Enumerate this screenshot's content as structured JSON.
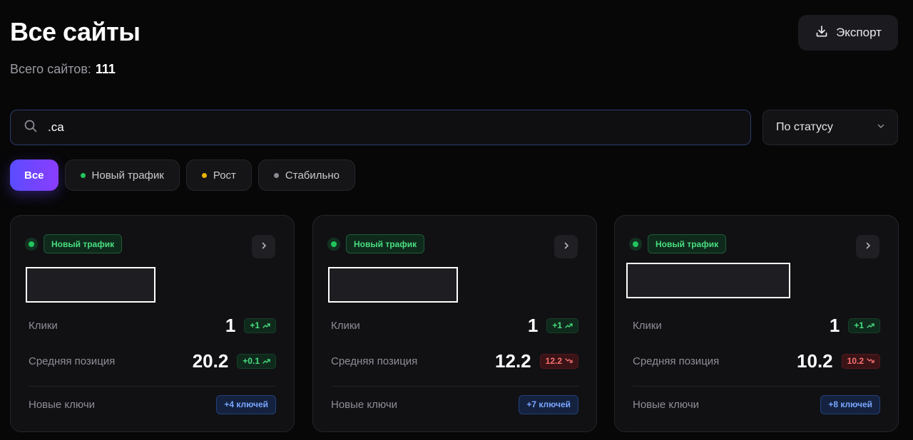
{
  "header": {
    "title": "Все сайты",
    "total_label": "Всего сайтов:",
    "total_value": "111",
    "export_label": "Экспорт"
  },
  "search": {
    "value": ".ca",
    "placeholder": ""
  },
  "status_select": {
    "selected": "По статусу"
  },
  "filters": [
    {
      "label": "Все",
      "active": true
    },
    {
      "label": "Новый трафик",
      "dot_color": "#22c55e"
    },
    {
      "label": "Рост",
      "dot_color": "#eab308"
    },
    {
      "label": "Стабильно",
      "dot_color": "#8a8a93"
    }
  ],
  "cards": [
    {
      "status": "Новый трафик",
      "clicks_label": "Клики",
      "clicks_value": "1",
      "clicks_delta": "+1",
      "position_label": "Средняя позиция",
      "position_value": "20.2",
      "position_delta": "+0.1",
      "keys_label": "Новые ключи",
      "keys_value": "+4 ключей"
    },
    {
      "status": "Новый трафик",
      "clicks_label": "Клики",
      "clicks_value": "1",
      "clicks_delta": "+1",
      "position_label": "Средняя позиция",
      "position_value": "12.2",
      "position_delta": "12.2",
      "keys_label": "Новые ключи",
      "keys_value": "+7 ключей"
    },
    {
      "status": "Новый трафик",
      "clicks_label": "Клики",
      "clicks_value": "1",
      "clicks_delta": "+1",
      "position_label": "Средняя позиция",
      "position_value": "10.2",
      "position_delta": "10.2",
      "keys_label": "Новые ключи",
      "keys_value": "+8 ключей"
    }
  ],
  "colors": {
    "accent_start": "#5a4cff",
    "accent_end": "#8b3dff",
    "positive": "#4ade80",
    "negative": "#f87171",
    "info": "#7aa6ff"
  },
  "icons": {
    "export": "download-icon",
    "search": "search-icon",
    "select": "chevron-down-icon",
    "card_open": "chevron-right-icon",
    "trend_up": "trend-up-icon",
    "trend_down": "trend-down-icon"
  }
}
